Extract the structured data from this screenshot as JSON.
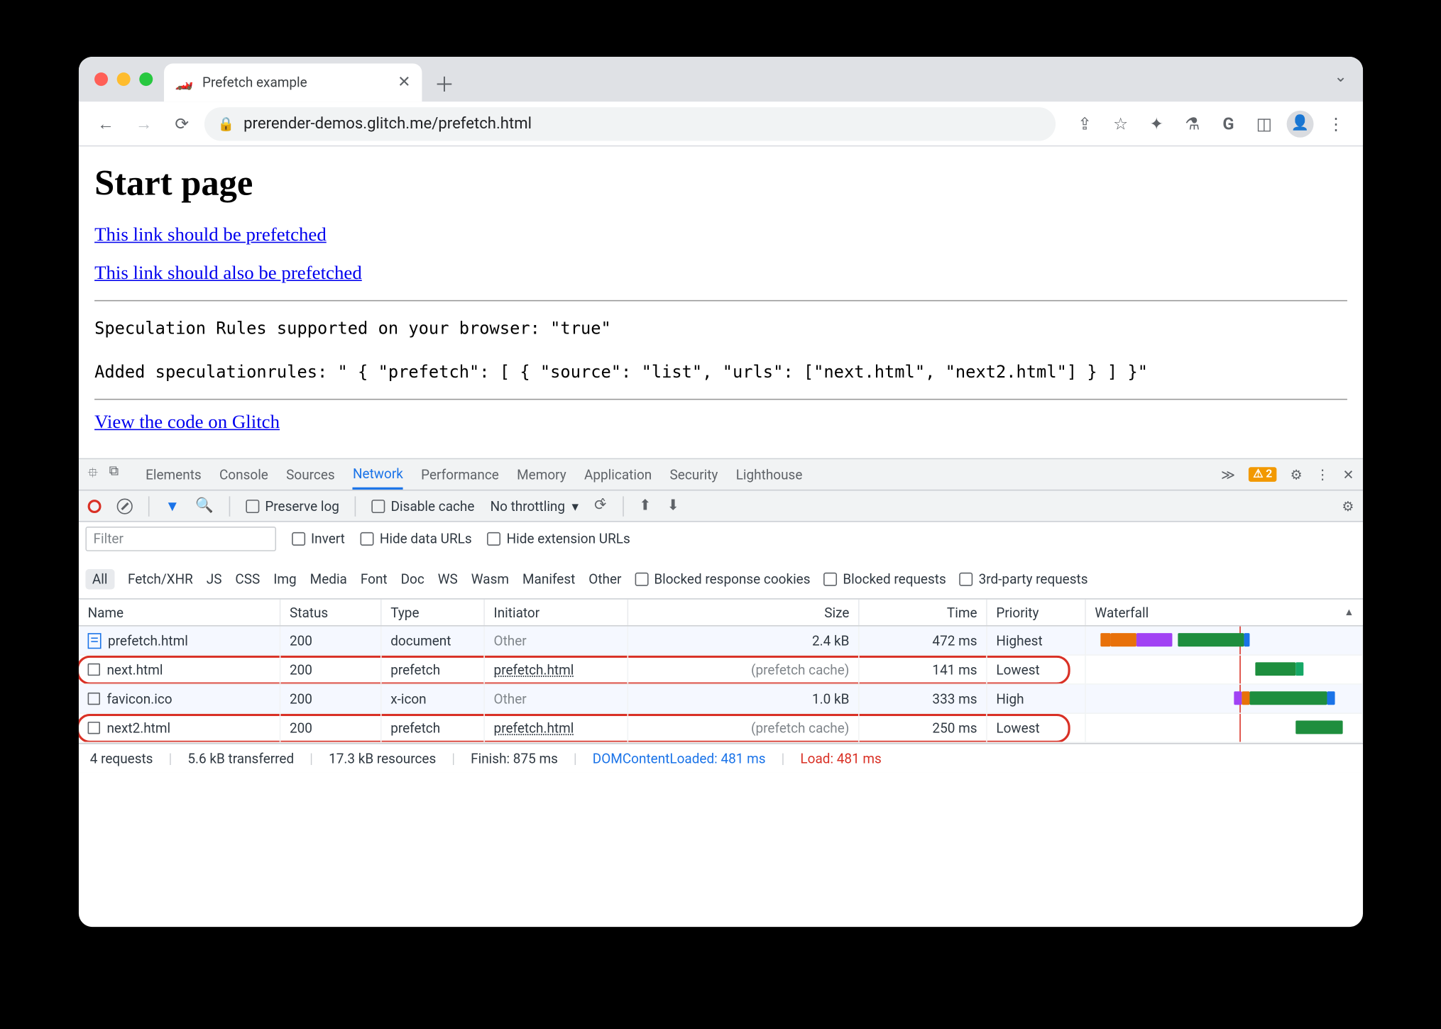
{
  "tab": {
    "title": "Prefetch example",
    "favicon": "🏎️"
  },
  "url": "prerender-demos.glitch.me/prefetch.html",
  "page": {
    "heading": "Start page",
    "link1": "This link should be prefetched",
    "link2": "This link should also be prefetched",
    "mono1": "Speculation Rules supported on your browser: \"true\"",
    "mono2": "Added speculationrules: \" { \"prefetch\": [ { \"source\": \"list\", \"urls\": [\"next.html\", \"next2.html\"] } ] }\"",
    "glitchlink": "View the code on Glitch"
  },
  "devtabs": {
    "elements": "Elements",
    "console": "Console",
    "sources": "Sources",
    "network": "Network",
    "performance": "Performance",
    "memory": "Memory",
    "application": "Application",
    "security": "Security",
    "lighthouse": "Lighthouse",
    "warncount": "2"
  },
  "toolbar": {
    "preserve": "Preserve log",
    "disable": "Disable cache",
    "throttle": "No throttling"
  },
  "filter": {
    "placeholder": "Filter",
    "invert": "Invert",
    "hidedata": "Hide data URLs",
    "hideext": "Hide extension URLs",
    "types": {
      "all": "All",
      "fx": "Fetch/XHR",
      "js": "JS",
      "css": "CSS",
      "img": "Img",
      "media": "Media",
      "font": "Font",
      "doc": "Doc",
      "ws": "WS",
      "wasm": "Wasm",
      "manifest": "Manifest",
      "other": "Other"
    },
    "brc": "Blocked response cookies",
    "br": "Blocked requests",
    "tp": "3rd-party requests"
  },
  "columns": {
    "name": "Name",
    "status": "Status",
    "type": "Type",
    "initiator": "Initiator",
    "size": "Size",
    "time": "Time",
    "priority": "Priority",
    "waterfall": "Waterfall"
  },
  "rows": [
    {
      "name": "prefetch.html",
      "status": "200",
      "type": "document",
      "initiator": "Other",
      "initmuted": true,
      "size": "2.4 kB",
      "time": "472 ms",
      "priority": "Highest",
      "isdoc": true
    },
    {
      "name": "next.html",
      "status": "200",
      "type": "prefetch",
      "initiator": "prefetch.html",
      "initmuted": false,
      "size": "(prefetch cache)",
      "sizemuted": true,
      "time": "141 ms",
      "priority": "Lowest"
    },
    {
      "name": "favicon.ico",
      "status": "200",
      "type": "x-icon",
      "initiator": "Other",
      "initmuted": true,
      "size": "1.0 kB",
      "time": "333 ms",
      "priority": "High"
    },
    {
      "name": "next2.html",
      "status": "200",
      "type": "prefetch",
      "initiator": "prefetch.html",
      "initmuted": false,
      "size": "(prefetch cache)",
      "sizemuted": true,
      "time": "250 ms",
      "priority": "Lowest"
    }
  ],
  "summary": {
    "requests": "4 requests",
    "transferred": "5.6 kB transferred",
    "resources": "17.3 kB resources",
    "finish": "Finish: 875 ms",
    "dcl": "DOMContentLoaded: 481 ms",
    "load": "Load: 481 ms"
  }
}
